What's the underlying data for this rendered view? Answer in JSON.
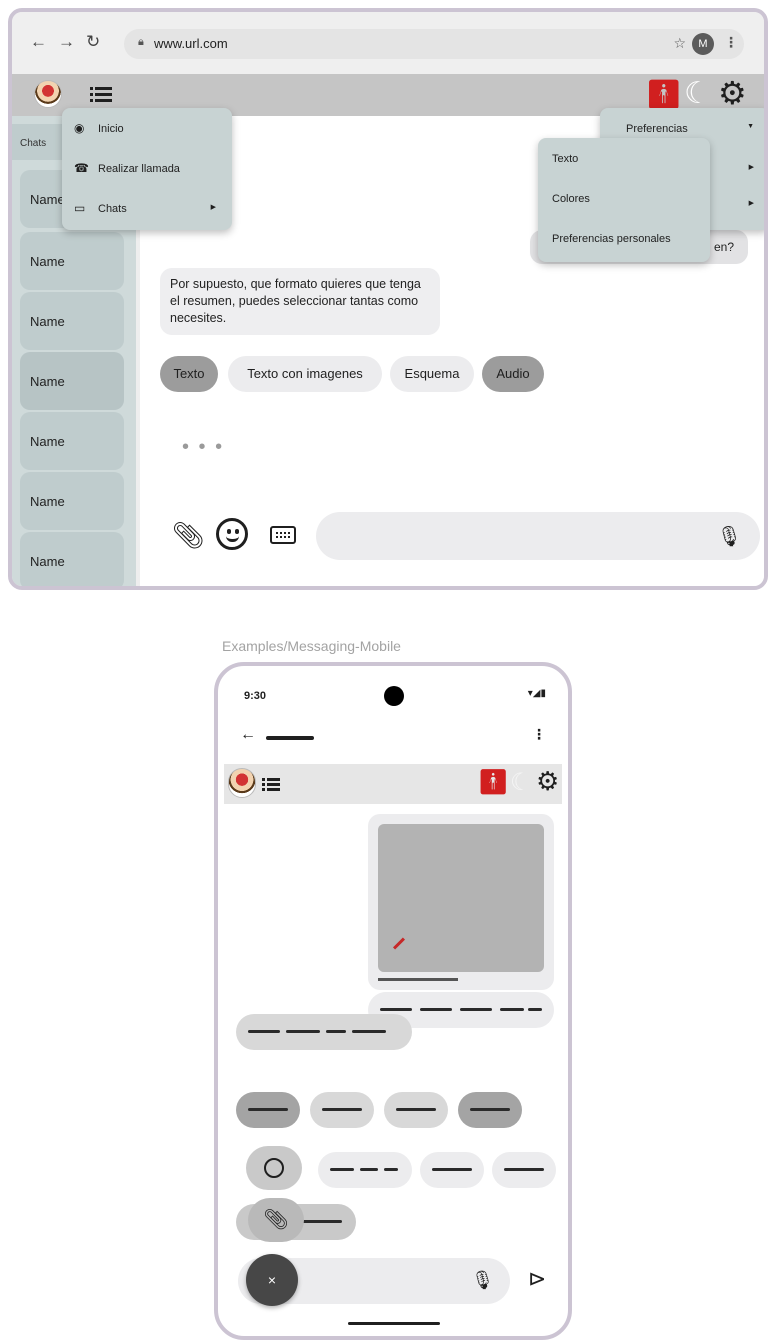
{
  "browser": {
    "nav": {
      "back_icon": "arrow-left-icon",
      "forward_icon": "arrow-right-icon",
      "reload_icon": "reload-icon"
    },
    "url": "www.url.com",
    "avatar_letter": "M"
  },
  "app": {
    "sidebar": {
      "header": "Chats",
      "items": [
        "Name",
        "Name",
        "Name",
        "Name",
        "Name",
        "Name",
        "Name"
      ]
    },
    "main_menu": {
      "items": [
        {
          "label": "Inicio",
          "icon": "home-circle-icon"
        },
        {
          "label": "Realizar llamada",
          "icon": "phone-icon"
        },
        {
          "label": "Chats",
          "icon": "chat-icon"
        }
      ]
    },
    "prefs_menu": {
      "title": "Preferencias"
    },
    "prefs_submenu": {
      "items": [
        "Texto",
        "Colores",
        "Preferencias personales"
      ]
    },
    "chat": {
      "outgoing_peek": "en?",
      "incoming": "Por supuesto, que formato quieres que tenga el resumen, puedes seleccionar tantas como necesites.",
      "chips": [
        {
          "label": "Texto",
          "selected": true
        },
        {
          "label": "Texto con imagenes",
          "selected": false
        },
        {
          "label": "Esquema",
          "selected": false
        },
        {
          "label": "Audio",
          "selected": true
        }
      ],
      "typing": "• • •"
    },
    "colors": {
      "accent_red": "#d11f1f",
      "sidebar": "#cfdada",
      "header": "#c5c5c5"
    }
  },
  "mobile": {
    "caption": "Examples/Messaging-Mobile",
    "time": "9:30",
    "status_icons": "▾◢▮",
    "close_label": "×"
  }
}
